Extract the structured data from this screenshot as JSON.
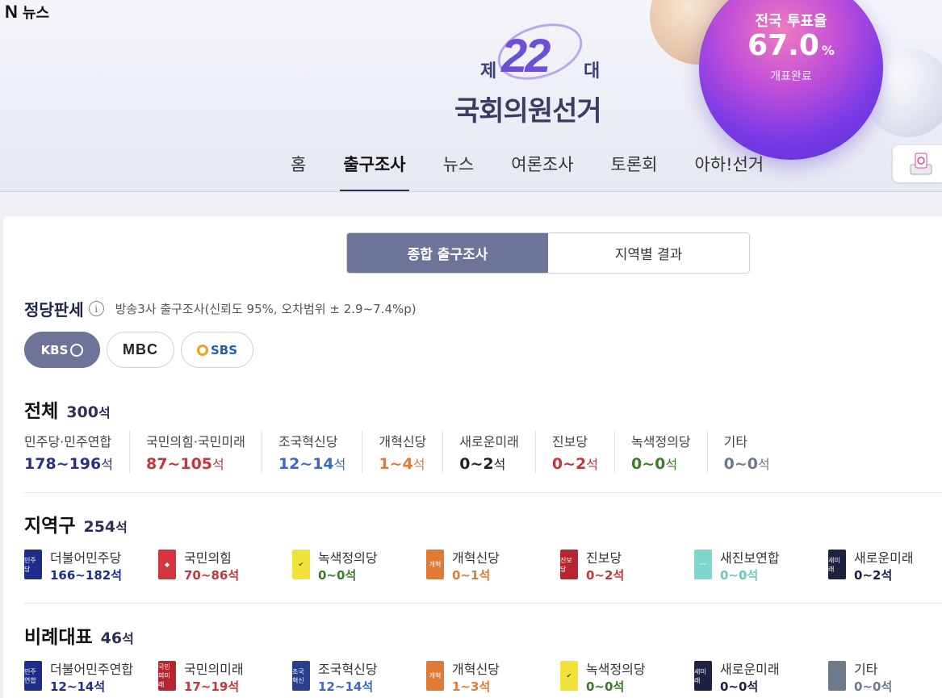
{
  "header": {
    "logo_n": "N",
    "logo_text": "뉴스",
    "emblem_je": "제",
    "emblem_num": "22",
    "emblem_dae": "대",
    "emblem_name": "국회의원선거"
  },
  "turnout": {
    "label": "전국 투표율",
    "value": "67.0",
    "unit": "%",
    "sub": "개표완료"
  },
  "nav": {
    "tabs": [
      "홈",
      "출구조사",
      "뉴스",
      "여론조사",
      "토론회",
      "아하!선거"
    ],
    "active": "출구조사"
  },
  "segment": {
    "left": "종합 출구조사",
    "right": "지역별 결과"
  },
  "party_status": {
    "title": "정당판세",
    "info_glyph": "i",
    "desc": "방송3사 출구조사(신뢰도 95%, 오차범위 ± 2.9~7.4%p)"
  },
  "broadcasters": [
    "KBS",
    "MBC",
    "SBS"
  ],
  "total": {
    "title": "전체",
    "count": "300",
    "unit": "석",
    "parties": [
      {
        "name": "민주당·민주연합",
        "range": "178~196",
        "unit": "석",
        "color": "#2b3185"
      },
      {
        "name": "국민의힘·국민미래",
        "range": "87~105",
        "unit": "석",
        "color": "#c8343c"
      },
      {
        "name": "조국혁신당",
        "range": "12~14",
        "unit": "석",
        "color": "#3c67c4"
      },
      {
        "name": "개혁신당",
        "range": "1~4",
        "unit": "석",
        "color": "#e27a35"
      },
      {
        "name": "새로운미래",
        "range": "0~2",
        "unit": "석",
        "color": "#222"
      },
      {
        "name": "진보당",
        "range": "0~2",
        "unit": "석",
        "color": "#c8343c"
      },
      {
        "name": "녹색정의당",
        "range": "0~0",
        "unit": "석",
        "color": "#3d7a2a"
      },
      {
        "name": "기타",
        "range": "0~0",
        "unit": "석",
        "color": "#6d7a8a"
      }
    ]
  },
  "district": {
    "title": "지역구",
    "count": "254",
    "unit": "석",
    "parties": [
      {
        "name": "더불어민주당",
        "range": "166~182석",
        "color": "#1f2d8a",
        "box": "#1f2d8a",
        "mark": "민주당"
      },
      {
        "name": "국민의힘",
        "range": "70~86석",
        "color": "#c8343c",
        "box": "#d4343c",
        "mark": "◆"
      },
      {
        "name": "녹색정의당",
        "range": "0~0석",
        "color": "#3d7a2a",
        "box": "#f3e23a",
        "mark": "✔"
      },
      {
        "name": "개혁신당",
        "range": "0~1석",
        "color": "#e27a35",
        "box": "#e27a35",
        "mark": "개혁"
      },
      {
        "name": "진보당",
        "range": "0~2석",
        "color": "#c8343c",
        "box": "#b8252f",
        "mark": "진보당"
      },
      {
        "name": "새진보연합",
        "range": "0~0석",
        "color": "#6cc7bd",
        "box": "#7fd6cc",
        "mark": "〰"
      },
      {
        "name": "새로운미래",
        "range": "0~2석",
        "color": "#1c2240",
        "box": "#1c2240",
        "mark": "새미래"
      }
    ]
  },
  "proportional": {
    "title": "비례대표",
    "count": "46",
    "unit": "석",
    "parties": [
      {
        "name": "더불어민주연합",
        "range": "12~14석",
        "color": "#1f2d8a",
        "box": "#1f2d8a",
        "mark": "민주연합"
      },
      {
        "name": "국민의미래",
        "range": "17~19석",
        "color": "#c8343c",
        "box": "#b8252f",
        "mark": "국민의미래"
      },
      {
        "name": "조국혁신당",
        "range": "12~14석",
        "color": "#3c67c4",
        "box": "#2c3f8f",
        "mark": "조국혁신"
      },
      {
        "name": "개혁신당",
        "range": "1~3석",
        "color": "#e27a35",
        "box": "#e27a35",
        "mark": "개혁"
      },
      {
        "name": "녹색정의당",
        "range": "0~0석",
        "color": "#3d7a2a",
        "box": "#f3e23a",
        "mark": "✔"
      },
      {
        "name": "새로운미래",
        "range": "0~0석",
        "color": "#1c2240",
        "box": "#1c2240",
        "mark": "새미래"
      },
      {
        "name": "기타",
        "range": "0~0석",
        "color": "#6d7a8a",
        "box": "#6d7a8a",
        "mark": ""
      }
    ]
  }
}
